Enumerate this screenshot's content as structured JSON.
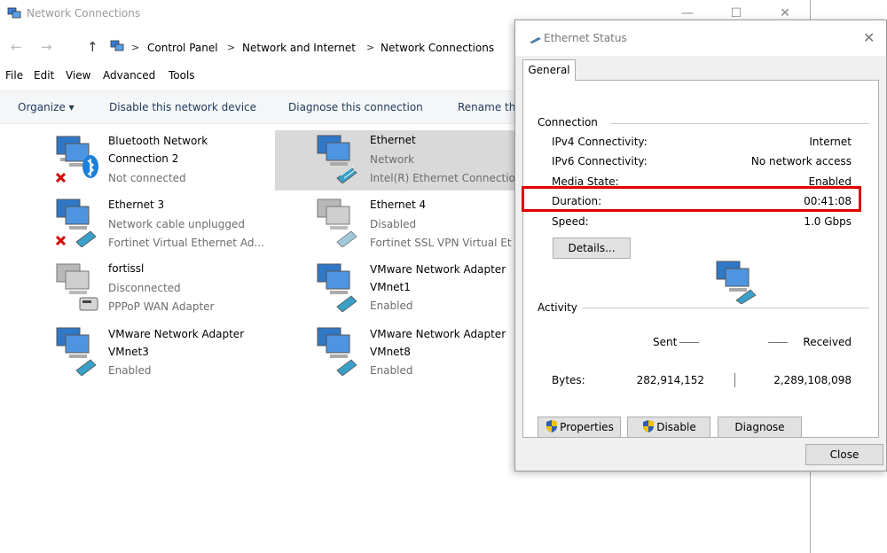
{
  "explorer": {
    "title": "Network Connections",
    "controls": {
      "minimize": "—",
      "maximize": "☐",
      "close": "✕"
    },
    "nav": {
      "back": "←",
      "forward": "→",
      "up": "↑"
    },
    "breadcrumb": [
      "Control Panel",
      "Network and Internet",
      "Network Connections"
    ],
    "breadcrumb_sep": ">",
    "menu": [
      "File",
      "Edit",
      "View",
      "Advanced",
      "Tools"
    ],
    "commands": {
      "organize": "Organize ▾",
      "disable": "Disable this network device",
      "diagnose": "Diagnose this connection",
      "rename": "Rename th"
    },
    "connections": [
      {
        "name": "Bluetooth Network",
        "line2": "Connection 2",
        "line3": "Not connected",
        "icon": "bluetooth-network-icon"
      },
      {
        "name": "Ethernet",
        "line2": "Network",
        "line3": "Intel(R) Ethernet Connection",
        "icon": "ethernet-network-icon"
      },
      {
        "name": "Ethernet 3",
        "line2": "Network cable unplugged",
        "line3": "Fortinet Virtual Ethernet Ad...",
        "icon": "ethernet-disconnected-icon"
      },
      {
        "name": "Ethernet 4",
        "line2": "Disabled",
        "line3": "Fortinet SSL VPN Virtual Et...",
        "icon": "ethernet-disabled-icon"
      },
      {
        "name": "fortissl",
        "line2": "Disconnected",
        "line3": "PPPoP WAN Adapter",
        "icon": "modem-disconnected-icon"
      },
      {
        "name": "VMware Network Adapter",
        "line2": "VMnet1",
        "line3": "Enabled",
        "icon": "vmware-adapter-icon"
      },
      {
        "name": "VMware Network Adapter",
        "line2": "VMnet3",
        "line3": "Enabled",
        "icon": "vmware-adapter-icon"
      },
      {
        "name": "VMware Network Adapter",
        "line2": "VMnet8",
        "line3": "Enabled",
        "icon": "vmware-adapter-icon"
      }
    ]
  },
  "dialog": {
    "title": "Ethernet Status",
    "close": "✕",
    "tab": "General",
    "connection": {
      "label": "Connection",
      "rows": [
        {
          "label": "IPv4 Connectivity:",
          "value": "Internet"
        },
        {
          "label": "IPv6 Connectivity:",
          "value": "No network access"
        },
        {
          "label": "Media State:",
          "value": "Enabled"
        },
        {
          "label": "Duration:",
          "value": "00:41:08"
        },
        {
          "label": "Speed:",
          "value": "1.0 Gbps"
        }
      ],
      "details_button": "Details..."
    },
    "activity": {
      "label": "Activity",
      "sent_label": "Sent",
      "received_label": "Received",
      "bytes_label": "Bytes:",
      "bytes_sent": "282,914,152",
      "bytes_received": "2,289,108,098"
    },
    "buttons": {
      "properties": "Properties",
      "disable": "Disable",
      "diagnose": "Diagnose",
      "close": "Close"
    },
    "highlight_color": "#e00000"
  }
}
